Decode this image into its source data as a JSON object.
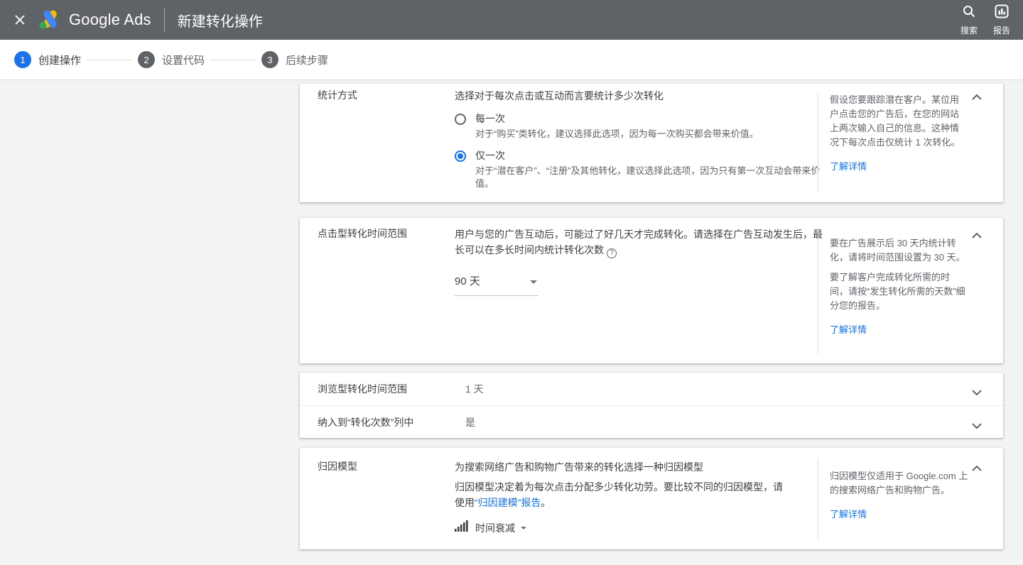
{
  "topbar": {
    "brand": "Google Ads",
    "title": "新建转化操作",
    "search_label": "搜索",
    "report_label": "报告"
  },
  "stepper": {
    "steps": [
      {
        "num": "1",
        "label": "创建操作"
      },
      {
        "num": "2",
        "label": "设置代码"
      },
      {
        "num": "3",
        "label": "后续步骤"
      }
    ]
  },
  "counting": {
    "label": "统计方式",
    "desc": "选择对于每次点击或互动而言要统计多少次转化",
    "options": [
      {
        "title": "每一次",
        "desc": "对于“购买”类转化，建议选择此选项，因为每一次购买都会带来价值。",
        "selected": false
      },
      {
        "title": "仅一次",
        "desc": "对于“潜在客户”、“注册”及其他转化，建议选择此选项，因为只有第一次互动会带来价值。",
        "selected": true
      }
    ],
    "help": "假设您要跟踪潜在客户。某位用户点击您的广告后，在您的网站上两次输入自己的信息。这种情况下每次点击仅统计 1 次转化。",
    "learn_more": "了解详情"
  },
  "click_window": {
    "label": "点击型转化时间范围",
    "desc": "用户与您的广告互动后，可能过了好几天才完成转化。请选择在广告互动发生后，最长可以在多长时间内统计转化次数",
    "value": "90 天",
    "help_p1": "要在广告展示后 30 天内统计转化，请将时间范围设置为 30 天。",
    "help_p2": "要了解客户完成转化所需的时间，请按“发生转化所需的天数”细分您的报告。",
    "learn_more": "了解详情"
  },
  "rows": {
    "view_window": {
      "label": "浏览型转化时间范围",
      "value": "1 天"
    },
    "include_column": {
      "label": "纳入到“转化次数”列中",
      "value": "是"
    }
  },
  "attribution": {
    "label": "归因模型",
    "desc1": "为搜索网络广告和购物广告带来的转化选择一种归因模型",
    "desc2_pre": "归因模型决定着为每次点击分配多少转化功劳。要比较不同的归因模型，请使用",
    "desc2_link": "“归因建模”报告",
    "desc2_post": "。",
    "value": "时间衰减",
    "help": "归因模型仅适用于 Google.com 上的搜索网络广告和购物广告。",
    "learn_more": "了解详情"
  },
  "colors": {
    "accent_blue": "#1a73e8",
    "topbar_bg": "#5f6368",
    "page_bg": "#f1f3f4",
    "logo_yellow": "#fbbc04",
    "logo_blue": "#4285f4",
    "logo_green": "#34a853"
  }
}
